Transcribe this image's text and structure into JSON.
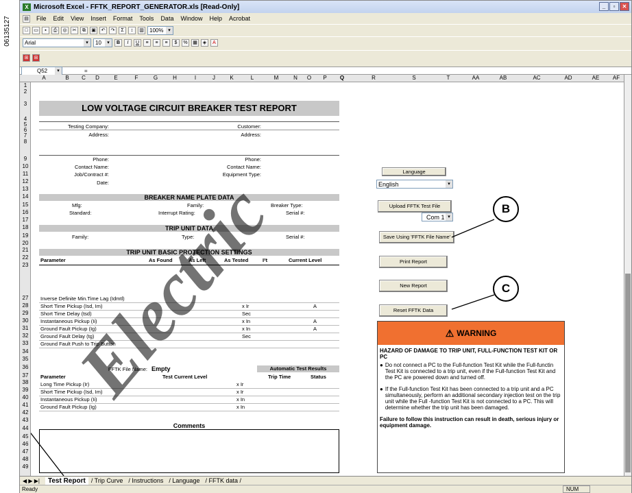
{
  "figure_id": "06135127",
  "window": {
    "title": "Microsoft Excel - FFTK_REPORT_GENERATOR.xls [Read-Only]"
  },
  "menu": [
    "File",
    "Edit",
    "View",
    "Insert",
    "Format",
    "Tools",
    "Data",
    "Window",
    "Help",
    "Acrobat"
  ],
  "toolbar": {
    "zoom": "100%",
    "font": "Arial",
    "size": "10"
  },
  "formula_bar": {
    "cell_ref": "Q52",
    "eq": "="
  },
  "columns": [
    "A",
    "B",
    "C",
    "D",
    "E",
    "F",
    "G",
    "H",
    "I",
    "J",
    "K",
    "L",
    "M",
    "N",
    "O",
    "P",
    "Q",
    "R",
    "S",
    "T",
    "AA",
    "AB",
    "AC",
    "AD",
    "AE",
    "AF"
  ],
  "rows": [
    "1",
    "2",
    "3",
    "4",
    "5",
    "6",
    "7",
    "8",
    "9",
    "10",
    "11",
    "12",
    "13",
    "14",
    "15",
    "16",
    "17",
    "18",
    "19",
    "20",
    "21",
    "22",
    "23",
    "27",
    "28",
    "29",
    "30",
    "31",
    "32",
    "33",
    "34",
    "35",
    "36",
    "37",
    "38",
    "39",
    "40",
    "41",
    "42",
    "43",
    "44",
    "45",
    "46",
    "47",
    "48",
    "49"
  ],
  "report": {
    "title": "LOW VOLTAGE CIRCUIT BREAKER TEST REPORT",
    "testing_company": "Testing Company:",
    "address": "Address:",
    "customer": "Customer:",
    "address2": "Address:",
    "phone": "Phone:",
    "phone2": "Phone:",
    "contact_name": "Contact Name:",
    "contact_name2": "Contact Name:",
    "job": "Job/Contract #:",
    "equipment": "Equipment Type:",
    "date": "Date:",
    "nameplate_header": "BREAKER NAME PLATE DATA",
    "mfg": "Mfg:",
    "family": "Family:",
    "breaker_type": "Breaker Type:",
    "standard": "Standard:",
    "interrupt": "Interrupt Rating:",
    "serial": "Serial #:",
    "trip_header": "TRIP UNIT DATA",
    "trip_family": "Family:",
    "trip_type": "Type:",
    "trip_serial": "Serial #:",
    "basic_header": "TRIP UNIT BASIC PROTECTION SETTINGS",
    "cols": [
      "Parameter",
      "As Found",
      "As Left",
      "As Tested",
      "I²t",
      "Current Level"
    ],
    "rows27": [
      {
        "p": "Inverse Definite Min.Time Lag (Idmtl)",
        "u": "",
        "c": ""
      },
      {
        "p": "Short Time Pickup (Isd, Im)",
        "u": "x Ir",
        "c": "A"
      },
      {
        "p": "Short Time Delay (tsd)",
        "u": "Sec",
        "c": ""
      },
      {
        "p": "Instantaneous Pickup (Ii)",
        "u": "x In",
        "c": "A"
      },
      {
        "p": "Ground Fault Pickup (Ig)",
        "u": "x In",
        "c": "A"
      },
      {
        "p": "Ground Fault Delay (tg)",
        "u": "Sec",
        "c": ""
      },
      {
        "p": "Ground Fault Push to Trip Button",
        "u": "",
        "c": ""
      }
    ],
    "file_name_label": "FFTK File Name:",
    "file_name": "Empty",
    "auto_results": "Automatic Test Results",
    "cols2": [
      "Parameter",
      "Test Current Level",
      "Trip Time",
      "Status"
    ],
    "rows37": [
      {
        "p": "Long Time Pickup (Ir)",
        "u": "x Ir"
      },
      {
        "p": "Short Time Pickup (Isd, Im)",
        "u": "x Ir"
      },
      {
        "p": "Instantaneous Pickup (Ii)",
        "u": "x In"
      },
      {
        "p": "Ground Fault Pickup (Ig)",
        "u": "x In"
      }
    ],
    "comments": "Comments"
  },
  "panel": {
    "language_label": "Language",
    "language": "English",
    "upload": "Upload FFTK Test File",
    "com": "Com 1",
    "save": "Save Using 'FFTK File Name'",
    "print": "Print Report",
    "new": "New Report",
    "reset": "Reset FFTK Data"
  },
  "warning": {
    "title": "WARNING",
    "hazard": "HAZARD OF DAMAGE TO TRIP UNIT, FULL-FUNCTION TEST KIT OR PC",
    "b1": "Do not connect a PC to the Full-function Test Kit while the Full-functin Test Kit is connected to a trip unit, even if the Full-function Test Kit and the PC are powered down and turned off.",
    "b2": "If the Full-function Test Kit has been connected to a trip unit and a PC simultaneously, perform an additional secondary injection test on the trip unit while the Full -function Test Kit is not connected to a PC.  This will determine whether the trip unit has been damaged.",
    "footer": "Failure to follow this instruction can result in death, serious injury or equipment damage.",
    "color": "#f07030"
  },
  "callouts": {
    "b": "B",
    "c": "C"
  },
  "tabs": [
    "Test Report",
    "Trip Curve",
    "Instructions",
    "Language",
    "FFTK data"
  ],
  "status": {
    "ready": "Ready",
    "num": "NUM"
  },
  "watermark": "Electric"
}
